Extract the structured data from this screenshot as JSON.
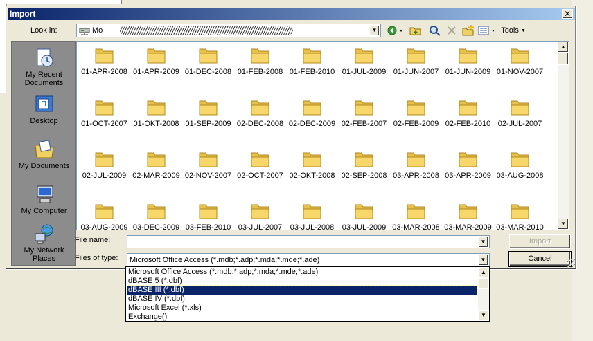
{
  "dialog": {
    "title": "Import",
    "close_glyph": "✕"
  },
  "look_in": {
    "label": "Look in:",
    "path_text": "Mo",
    "drive_icon": "network-drive-icon"
  },
  "toolbar": {
    "back_icon": "back-icon",
    "up_icon": "up-folder-icon",
    "search_icon": "search-web-icon",
    "delete_icon": "delete-icon",
    "new_folder_icon": "new-folder-icon",
    "views_icon": "views-icon",
    "tools_label": "Tools"
  },
  "places": [
    {
      "label": "My Recent Documents",
      "icon": "recent-documents-icon"
    },
    {
      "label": "Desktop",
      "icon": "desktop-icon"
    },
    {
      "label": "My Documents",
      "icon": "my-documents-icon"
    },
    {
      "label": "My Computer",
      "icon": "my-computer-icon"
    },
    {
      "label": "My Network Places",
      "icon": "network-places-icon"
    }
  ],
  "folders": [
    "01-APR-2008",
    "01-APR-2009",
    "01-DEC-2008",
    "01-FEB-2008",
    "01-FEB-2010",
    "01-JUL-2009",
    "01-JUN-2007",
    "01-JUN-2009",
    "01-NOV-2007",
    "01-OCT-2007",
    "01-OKT-2008",
    "01-SEP-2009",
    "02-DEC-2008",
    "02-DEC-2009",
    "02-FEB-2007",
    "02-FEB-2009",
    "02-FEB-2010",
    "02-JUL-2007",
    "02-JUL-2009",
    "02-MAR-2009",
    "02-NOV-2007",
    "02-OCT-2007",
    "02-OKT-2008",
    "02-SEP-2008",
    "03-APR-2008",
    "03-APR-2009",
    "03-AUG-2008",
    "03-AUG-2009",
    "03-DEC-2009",
    "03-FEB-2010",
    "03-JUL-2007",
    "03-JUL-2008",
    "03-JUL-2009",
    "03-MAR-2008",
    "03-MAR-2009",
    "03-MAR-2010"
  ],
  "file_name": {
    "label_pre": "File ",
    "label_u": "n",
    "label_post": "ame:",
    "value": ""
  },
  "files_of_type": {
    "label_pre": "Files of ",
    "label_u": "t",
    "label_post": "ype:",
    "selected": "Microsoft Office Access (*.mdb;*.adp;*.mda;*.mde;*.ade)",
    "options": [
      "Microsoft Office Access (*.mdb;*.adp;*.mda;*.mde;*.ade)",
      "dBASE 5 (*.dbf)",
      "dBASE III (*.dbf)",
      "dBASE IV (*.dbf)",
      "Microsoft Excel (*.xls)",
      "Exchange()"
    ],
    "highlighted_index": 2
  },
  "buttons": {
    "import_label": "Import",
    "cancel_label": "Cancel"
  },
  "colors": {
    "titlebar_start": "#0a246a",
    "folder_yellow": "#f7d66a",
    "selection": "#0a246a"
  }
}
